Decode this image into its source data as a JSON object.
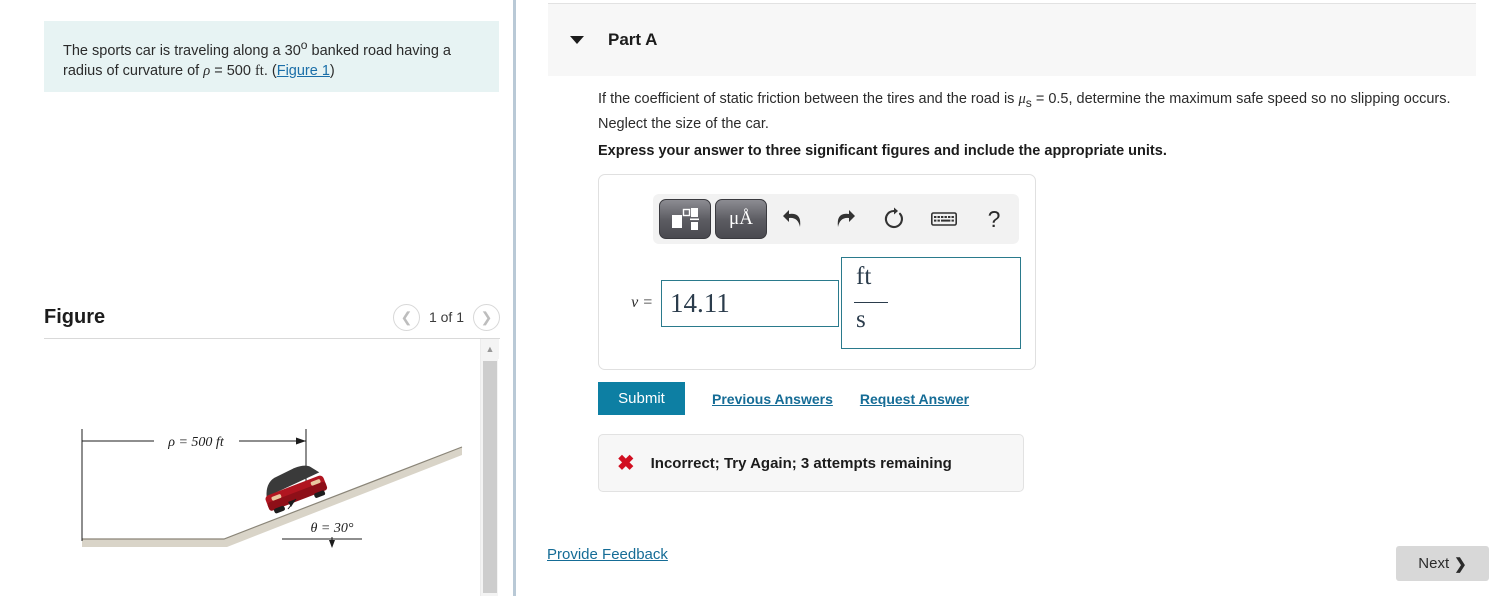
{
  "problem": {
    "text_part1": "The sports car is traveling along a 30",
    "degree": "o",
    "text_part2": " banked road having a radius of curvature of ",
    "rho_symbol": "ρ",
    "rho_value": " = 500 ",
    "unit": "ft",
    "text_part3": ". (",
    "figure_link": "Figure 1",
    "text_part4": ")"
  },
  "figure": {
    "title": "Figure",
    "counter": "1 of 1",
    "prev_icon": "chevron-left-icon",
    "next_icon": "chevron-right-icon",
    "scroll_up_icon": "caret-up-icon",
    "labels": {
      "radius": "ρ = 500 ft",
      "angle": "θ = 30°"
    }
  },
  "part": {
    "caret_icon": "caret-down-icon",
    "title": "Part A",
    "question_part1": "If the coefficient of static friction between the tires and the road is ",
    "mu_symbol": "μ",
    "mu_sub": "s",
    "mu_value": " = 0.5, determine the maximum safe speed so no slipping occurs. Neglect the size of the car.",
    "instruction": "Express your answer to three significant figures and include the appropriate units."
  },
  "toolbar": {
    "templates_icon": "math-templates-icon",
    "units_label": "μÅ",
    "undo_icon": "undo-arrow-icon",
    "redo_icon": "redo-arrow-icon",
    "reset_icon": "reset-circular-arrow-icon",
    "keyboard_icon": "keyboard-icon",
    "help_label": "?"
  },
  "answer": {
    "variable": "v =",
    "value": "14.11",
    "unit_numerator": "ft",
    "unit_denominator": "s"
  },
  "actions": {
    "submit": "Submit",
    "previous_answers": "Previous Answers",
    "request_answer": "Request Answer"
  },
  "feedback": {
    "icon": "x-mark-icon",
    "message": "Incorrect; Try Again; 3 attempts remaining"
  },
  "footer": {
    "provide_feedback": "Provide Feedback",
    "next": "Next",
    "next_chevron": "❯"
  },
  "colors": {
    "accent": "#0d7fa3",
    "link": "#156c96",
    "error": "#d10f21",
    "problem_bg": "#e7f3f3",
    "field_border": "#2a7a8c"
  }
}
